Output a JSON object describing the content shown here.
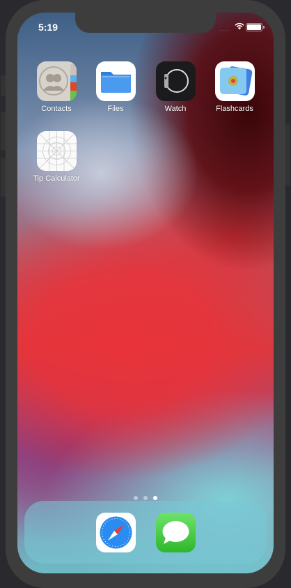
{
  "status_bar": {
    "time": "5:19",
    "wifi_icon": "wifi-icon",
    "battery_icon": "battery-icon"
  },
  "apps": [
    {
      "label": "Contacts",
      "icon": "contacts-icon"
    },
    {
      "label": "Files",
      "icon": "files-icon"
    },
    {
      "label": "Watch",
      "icon": "watch-icon"
    },
    {
      "label": "Flashcards",
      "icon": "flashcards-icon"
    },
    {
      "label": "Tip Calculator",
      "icon": "app-template-icon"
    }
  ],
  "page_indicator": {
    "pages": 3,
    "current": 3
  },
  "dock": [
    {
      "icon": "safari-icon"
    },
    {
      "icon": "messages-icon"
    }
  ]
}
